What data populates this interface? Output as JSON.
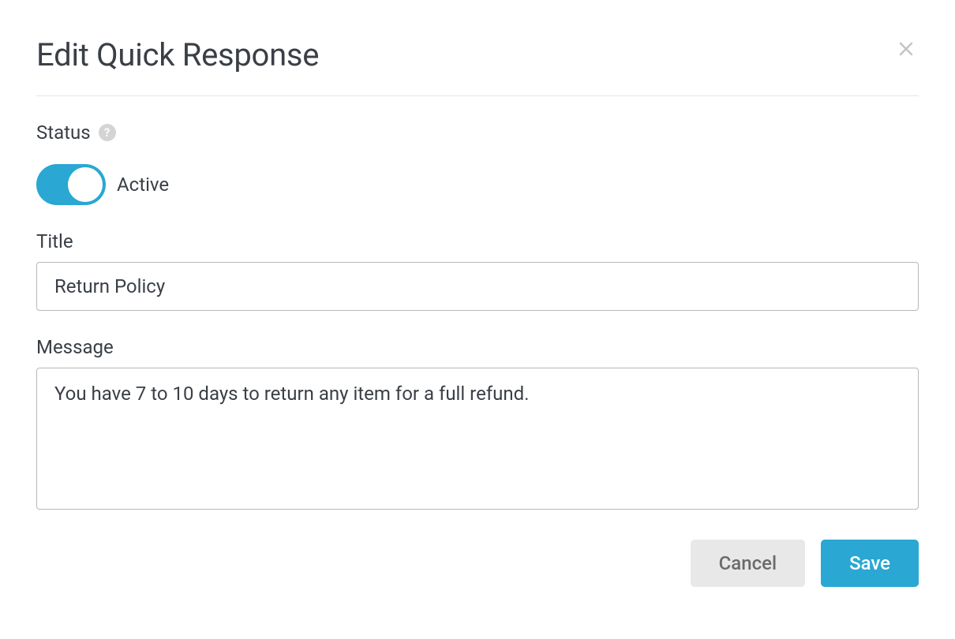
{
  "modal": {
    "title": "Edit Quick Response"
  },
  "form": {
    "status_label": "Status",
    "toggle_state_label": "Active",
    "title_label": "Title",
    "title_value": "Return Policy",
    "message_label": "Message",
    "message_value": "You have 7 to 10 days to return any item for a full refund."
  },
  "buttons": {
    "cancel": "Cancel",
    "save": "Save"
  }
}
